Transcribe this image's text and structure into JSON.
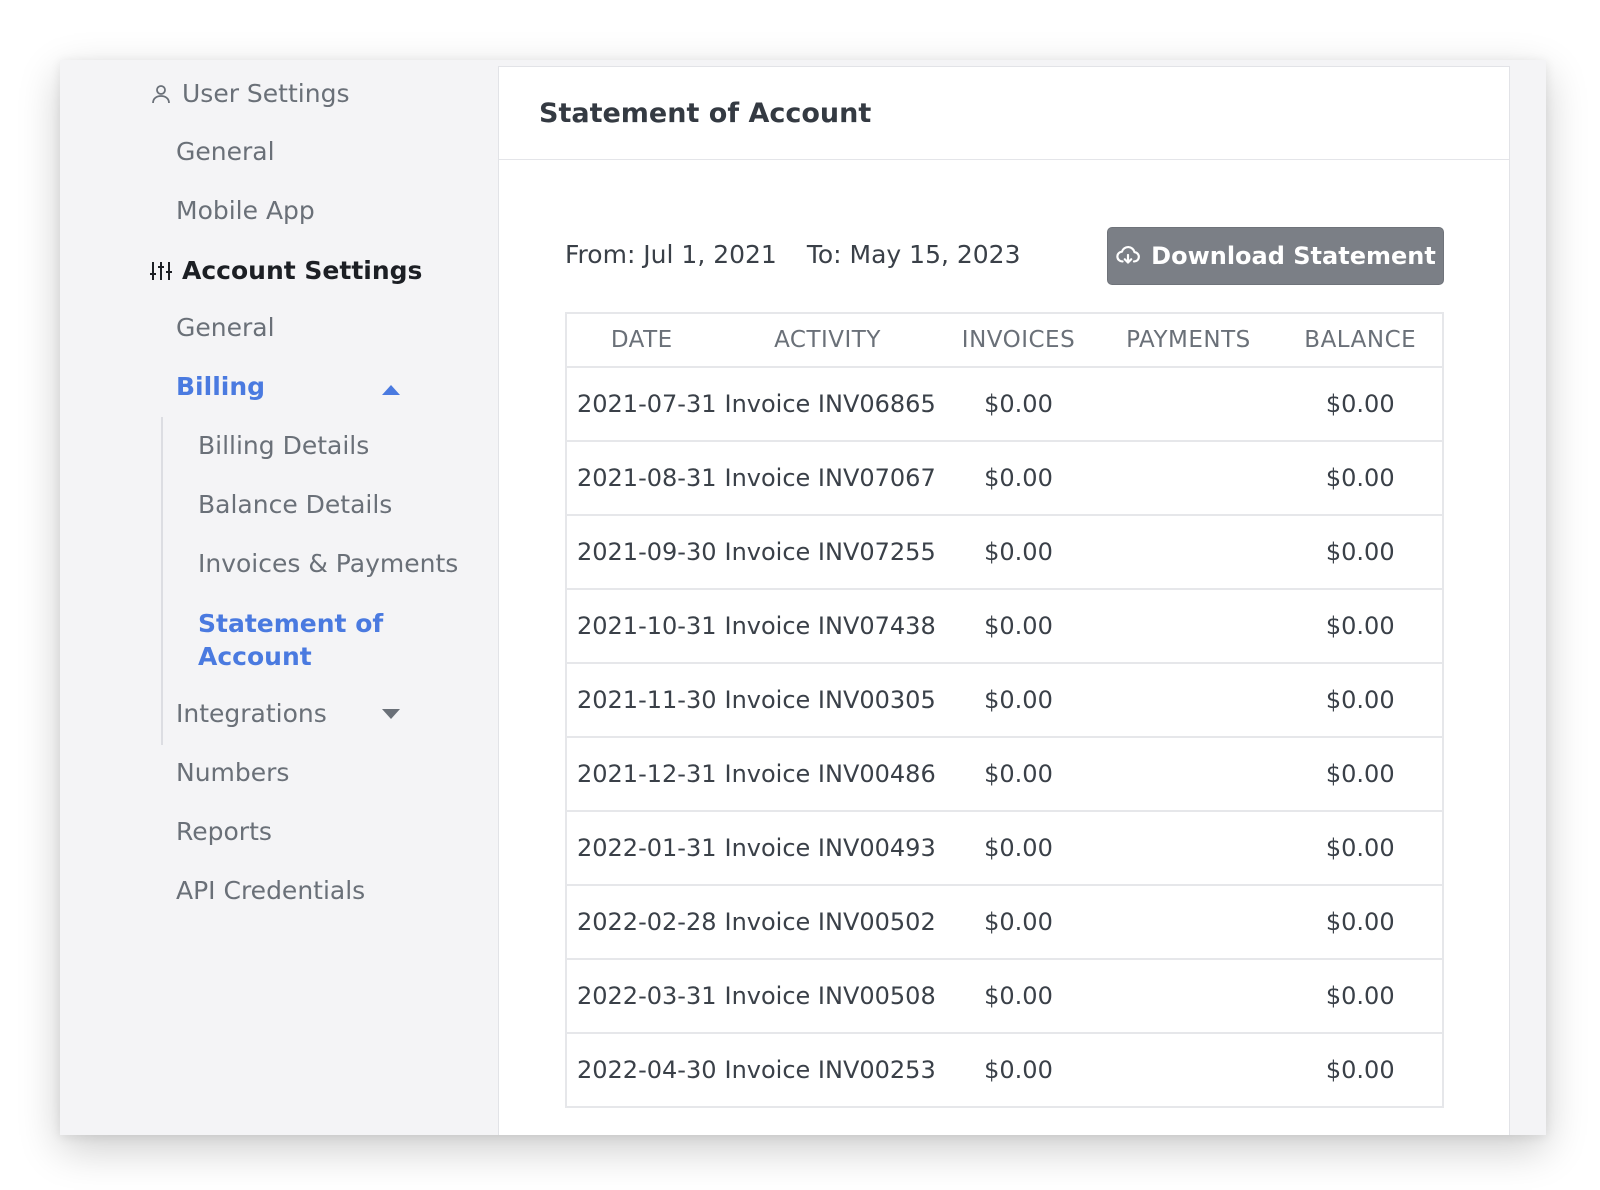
{
  "sidebar": {
    "user_settings": {
      "label": "User Settings",
      "icon": "user-icon",
      "items": [
        "General",
        "Mobile App"
      ]
    },
    "account_settings": {
      "label": "Account Settings",
      "icon": "sliders-icon",
      "general": "General",
      "billing": {
        "label": "Billing",
        "expanded": true,
        "items": [
          "Billing Details",
          "Balance Details",
          "Invoices & Payments",
          "Statement of Account"
        ]
      },
      "integrations": {
        "label": "Integrations",
        "expanded": false
      },
      "numbers": "Numbers",
      "reports": "Reports",
      "api_credentials": "API Credentials"
    }
  },
  "main": {
    "title": "Statement of Account",
    "from_label": "From: Jul 1, 2021",
    "to_label": "To: May 15, 2023",
    "download_label": "Download Statement",
    "download_icon": "cloud-download-icon",
    "table": {
      "columns": [
        "DATE",
        "ACTIVITY",
        "INVOICES",
        "PAYMENTS",
        "BALANCE"
      ],
      "rows": [
        {
          "date": "2021-07-31",
          "activity": "Invoice INV06865",
          "invoices": "$0.00",
          "payments": "",
          "balance": "$0.00"
        },
        {
          "date": "2021-08-31",
          "activity": "Invoice INV07067",
          "invoices": "$0.00",
          "payments": "",
          "balance": "$0.00"
        },
        {
          "date": "2021-09-30",
          "activity": "Invoice INV07255",
          "invoices": "$0.00",
          "payments": "",
          "balance": "$0.00"
        },
        {
          "date": "2021-10-31",
          "activity": "Invoice INV07438",
          "invoices": "$0.00",
          "payments": "",
          "balance": "$0.00"
        },
        {
          "date": "2021-11-30",
          "activity": "Invoice INV00305",
          "invoices": "$0.00",
          "payments": "",
          "balance": "$0.00"
        },
        {
          "date": "2021-12-31",
          "activity": "Invoice INV00486",
          "invoices": "$0.00",
          "payments": "",
          "balance": "$0.00"
        },
        {
          "date": "2022-01-31",
          "activity": "Invoice INV00493",
          "invoices": "$0.00",
          "payments": "",
          "balance": "$0.00"
        },
        {
          "date": "2022-02-28",
          "activity": "Invoice INV00502",
          "invoices": "$0.00",
          "payments": "",
          "balance": "$0.00"
        },
        {
          "date": "2022-03-31",
          "activity": "Invoice INV00508",
          "invoices": "$0.00",
          "payments": "",
          "balance": "$0.00"
        },
        {
          "date": "2022-04-30",
          "activity": "Invoice INV00253",
          "invoices": "$0.00",
          "payments": "",
          "balance": "$0.00"
        }
      ]
    }
  },
  "colors": {
    "accent": "#4a7ae0",
    "sidebar_bg": "#f4f4f6",
    "button_bg": "#7b7f86",
    "text": "#3a4048",
    "muted_text": "#6a7078",
    "border": "#e6e7ea"
  }
}
